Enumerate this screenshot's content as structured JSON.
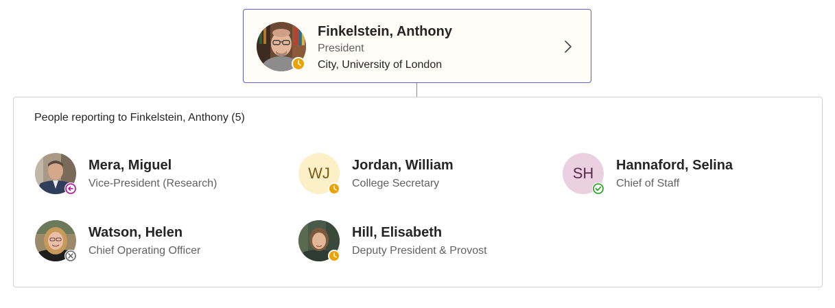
{
  "manager": {
    "name": "Finkelstein, Anthony",
    "title": "President",
    "organization": "City, University of London",
    "presence": "away",
    "chevron_icon": "chevron-right-icon"
  },
  "reports": {
    "heading": "People reporting to Finkelstein, Anthony (5)",
    "people": [
      {
        "name": "Mera, Miguel",
        "title": "Vice-President (Research)",
        "presence": "out-of-office"
      },
      {
        "name": "Jordan, William",
        "title": "College Secretary",
        "initials": "WJ",
        "presence": "away"
      },
      {
        "name": "Hannaford, Selina",
        "title": "Chief of Staff",
        "initials": "SH",
        "presence": "available"
      },
      {
        "name": "Watson, Helen",
        "title": "Chief Operating Officer",
        "presence": "offline"
      },
      {
        "name": "Hill, Elisabeth",
        "title": "Deputy President & Provost",
        "presence": "away"
      }
    ]
  },
  "colors": {
    "accent_border": "#5b5fc7",
    "away": "#eaa300",
    "available": "#13a10e",
    "out_of_office": "#b4009e",
    "offline": "#616161"
  }
}
